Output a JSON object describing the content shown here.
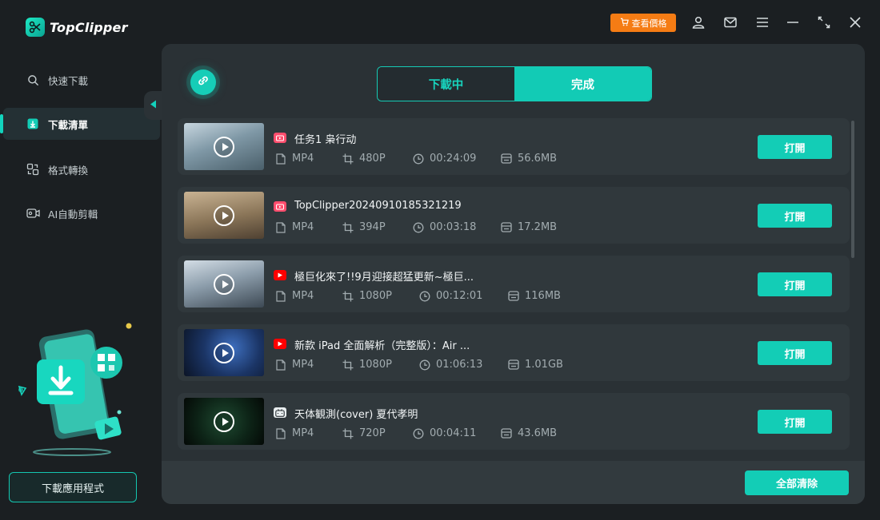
{
  "app": {
    "name": "TopClipper"
  },
  "header": {
    "price_label": "查看價格"
  },
  "sidebar": {
    "items": [
      {
        "label": "快速下載",
        "icon": "search-icon"
      },
      {
        "label": "下載清單",
        "icon": "download-list-icon",
        "active": true
      },
      {
        "label": "格式轉換",
        "icon": "convert-icon"
      },
      {
        "label": "AI自動剪輯",
        "icon": "ai-edit-icon"
      }
    ],
    "download_app_label": "下載應用程式"
  },
  "tabs": {
    "downloading": "下載中",
    "completed": "完成",
    "active": "completed"
  },
  "list": {
    "open_label": "打開",
    "items": [
      {
        "title": "任务1 枭行动",
        "source": "kuaishou",
        "format": "MP4",
        "resolution": "480P",
        "duration": "00:24:09",
        "size": "56.6MB",
        "thumb_colors": [
          "#9eb3bf",
          "#5d7683"
        ]
      },
      {
        "title": "TopClipper20240910185321219",
        "source": "kuaishou",
        "format": "MP4",
        "resolution": "394P",
        "duration": "00:03:18",
        "size": "17.2MB",
        "thumb_colors": [
          "#b59c7c",
          "#6e5a44"
        ]
      },
      {
        "title": "極巨化來了!!9月迎接超猛更新~極巨...",
        "source": "youtube",
        "format": "MP4",
        "resolution": "1080P",
        "duration": "00:12:01",
        "size": "116MB",
        "thumb_colors": [
          "#a9b8c4",
          "#566470"
        ]
      },
      {
        "title": "新款 iPad 全面解析（完整版）：Air ...",
        "source": "youtube",
        "format": "MP4",
        "resolution": "1080P",
        "duration": "01:06:13",
        "size": "1.01GB",
        "thumb_colors": [
          "#2b4a8a",
          "#0d1a33"
        ]
      },
      {
        "title": "天体観測(cover) 夏代孝明",
        "source": "bilibili",
        "format": "MP4",
        "resolution": "720P",
        "duration": "00:04:11",
        "size": "43.6MB",
        "thumb_colors": [
          "#12301f",
          "#050c08"
        ]
      }
    ]
  },
  "footer": {
    "clear_all_label": "全部清除"
  },
  "colors": {
    "accent": "#13cdb6",
    "price": "#f57c14",
    "youtube": "#ff0000",
    "kuaishou": "#ff4d6d"
  }
}
